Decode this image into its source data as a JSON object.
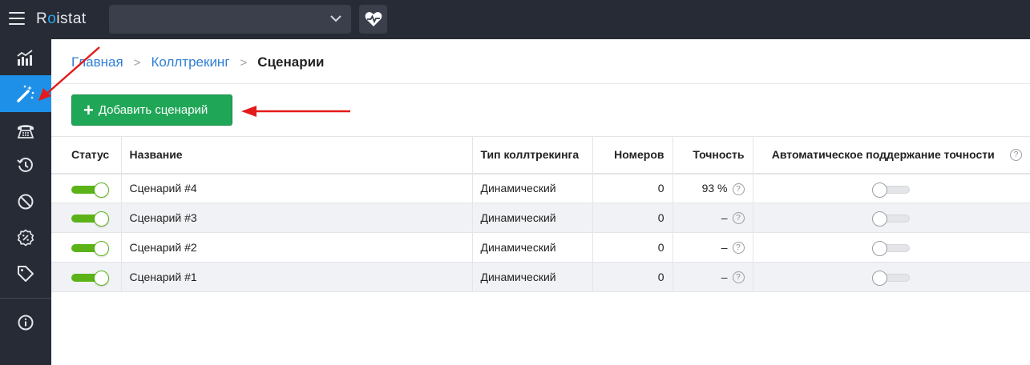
{
  "app": {
    "logo_prefix": "R",
    "logo_dot": "o",
    "logo_suffix": "istat",
    "project_select_value": ""
  },
  "sidebar": {
    "items": [
      {
        "icon": "analytics-icon"
      },
      {
        "icon": "magic-wand-icon",
        "active": true
      },
      {
        "icon": "phone-icon"
      },
      {
        "icon": "history-icon"
      },
      {
        "icon": "block-icon"
      },
      {
        "icon": "percent-badge-icon"
      },
      {
        "icon": "tag-icon"
      },
      {
        "icon": "info-icon"
      }
    ]
  },
  "breadcrumb": {
    "home": "Главная",
    "calltracking": "Коллтрекинг",
    "current": "Сценарии"
  },
  "add_button": {
    "label": "Добавить сценарий",
    "plus": "+"
  },
  "table": {
    "headers": {
      "status": "Статус",
      "name": "Название",
      "type": "Тип коллтрекинга",
      "numbers": "Номеров",
      "accuracy": "Точность",
      "auto": "Автоматическое поддержание точности"
    },
    "rows": [
      {
        "status_on": true,
        "name": "Сценарий #4",
        "type": "Динамический",
        "numbers": "0",
        "accuracy": "93 %",
        "auto_on": false
      },
      {
        "status_on": true,
        "name": "Сценарий #3",
        "type": "Динамический",
        "numbers": "0",
        "accuracy": "–",
        "auto_on": false
      },
      {
        "status_on": true,
        "name": "Сценарий #2",
        "type": "Динамический",
        "numbers": "0",
        "accuracy": "–",
        "auto_on": false
      },
      {
        "status_on": true,
        "name": "Сценарий #1",
        "type": "Динамический",
        "numbers": "0",
        "accuracy": "–",
        "auto_on": false
      }
    ]
  },
  "help_glyph": "?",
  "colors": {
    "topbar": "#272b35",
    "active": "#1e90e8",
    "primary_button": "#20a657",
    "toggle_on": "#5bb318",
    "link": "#2e7fd4",
    "annotation_arrow": "#e31b1b"
  }
}
